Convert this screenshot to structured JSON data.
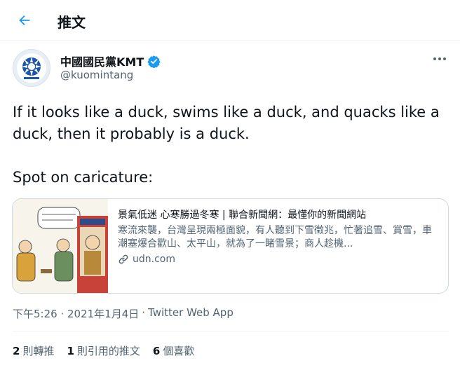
{
  "header": {
    "title": "推文"
  },
  "author": {
    "display_name": "中國國民黨KMT",
    "handle": "@kuomintang"
  },
  "tweet": {
    "lines": [
      "If it looks like a duck, swims like a duck, and quacks like a duck, then it probably is a duck.",
      "Spot on caricature:"
    ]
  },
  "card": {
    "title": "景氣低迷 心寒勝過冬寒 | 聯合新聞網：最懂你的新聞網站",
    "description": "寒流來襲，台灣呈現兩極面貌，有人聽到下雪徵兆，忙著追雪、賞雪，車潮塞爆合歡山、太平山，就為了一睹雪景；商人趁機...",
    "domain": "udn.com"
  },
  "meta": {
    "timestamp": "下午5:26 · 2021年1月4日",
    "separator": "·",
    "source": "Twitter Web App"
  },
  "stats": [
    {
      "count": "2",
      "label": "則轉推"
    },
    {
      "count": "1",
      "label": "則引用的推文"
    },
    {
      "count": "6",
      "label": "個喜歡"
    }
  ],
  "colors": {
    "accent": "#1d9bf0",
    "text": "#0f1419",
    "muted": "#536471",
    "border": "#cfd9de"
  },
  "icons": {
    "back": "arrow-left-icon",
    "verified": "verified-badge-icon",
    "more": "more-options-icon",
    "link": "link-icon"
  }
}
